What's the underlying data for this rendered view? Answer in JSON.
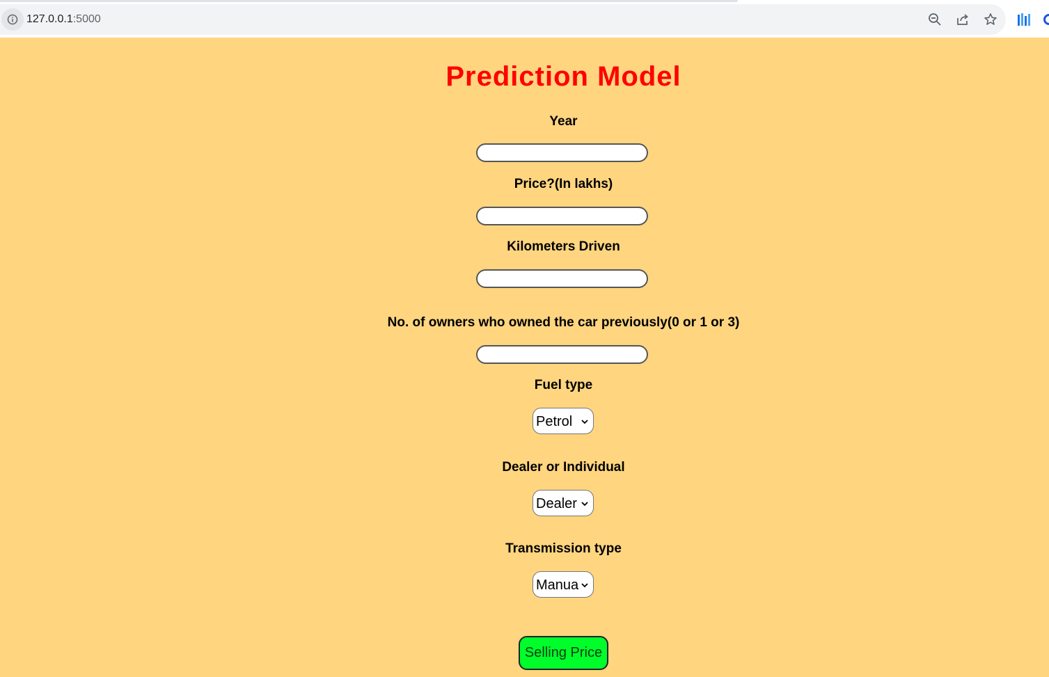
{
  "browser": {
    "url_host": "127.0.0.1",
    "url_port": ":5000",
    "icons": [
      "info-icon",
      "zoom-out-icon",
      "share-icon",
      "bookmark-star-icon",
      "extension-icon"
    ]
  },
  "page": {
    "background": "#ffd580",
    "title": "Prediction Model",
    "title_color": "#ff0000",
    "fields": {
      "year": {
        "label": "Year",
        "value": ""
      },
      "price": {
        "label": "Price?(In lakhs)",
        "value": ""
      },
      "kms": {
        "label": "Kilometers Driven",
        "value": ""
      },
      "owners": {
        "label": "No. of owners who owned the car previously(0 or 1 or 3)",
        "value": ""
      }
    },
    "selects": {
      "fuel": {
        "label": "Fuel type",
        "value": "Petrol"
      },
      "seller": {
        "label": "Dealer or Individual",
        "value": "Dealer"
      },
      "transmission": {
        "label": "Transmission type",
        "value": "Manua"
      }
    },
    "submit": {
      "label": "Selling Price",
      "color": "#00ff2a"
    }
  }
}
